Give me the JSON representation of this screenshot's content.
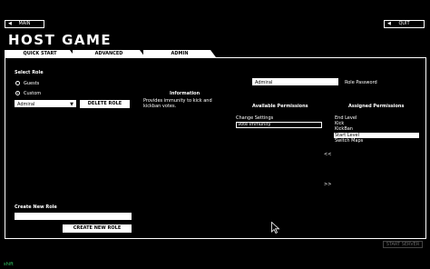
{
  "top_bar": {
    "main_label": "MAIN",
    "quit_label": "QUIT"
  },
  "page_title": "HOST GAME",
  "tabs": [
    {
      "label": "QUICK START"
    },
    {
      "label": "ADVANCED"
    },
    {
      "label": "ADMIN"
    }
  ],
  "roles": {
    "select_role_label": "Select Role",
    "option_guests": "Guests",
    "option_custom": "Custom",
    "selected_role": "Admiral",
    "delete_label": "DELETE ROLE"
  },
  "information": {
    "heading": "Information",
    "text": "Provides immunity to kick and kickban votes."
  },
  "role_password": {
    "value": "Admiral",
    "label": "Role Password"
  },
  "available_permissions": {
    "heading": "Available Permissions",
    "items": [
      "Change Settings",
      "Vote Immunity"
    ]
  },
  "assigned_permissions": {
    "heading": "Assigned Permissions",
    "items": [
      "End Level",
      "Kick",
      "KickBan",
      "Start Level",
      "Switch Maps"
    ]
  },
  "transfer": {
    "left": "<<",
    "right": ">>"
  },
  "create_role": {
    "label": "Create New Role",
    "value": "",
    "button_label": "CREATE NEW ROLE"
  },
  "start_server_label": "START SERVER",
  "shift_hint": "shift"
}
